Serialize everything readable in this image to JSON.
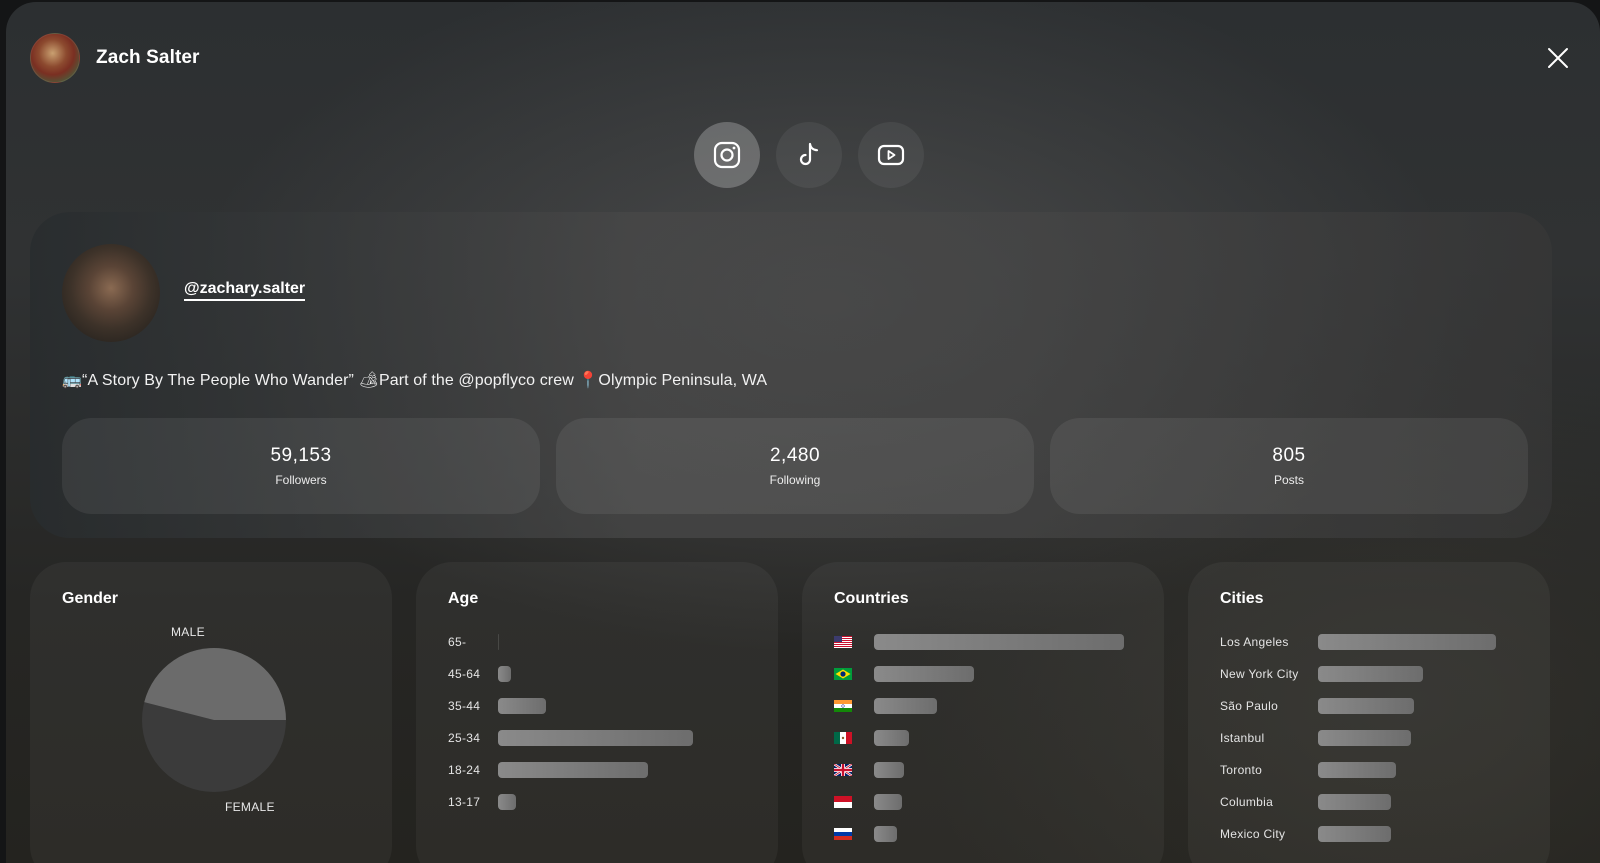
{
  "header": {
    "name": "Zach Salter"
  },
  "platforms": [
    {
      "name": "instagram",
      "active": true
    },
    {
      "name": "tiktok",
      "active": false
    },
    {
      "name": "youtube",
      "active": false
    }
  ],
  "profile": {
    "handle": "@zachary.salter",
    "bio": "🚌“A Story By The People Who Wander” 🏕Part of the @popflyco crew 📍Olympic Peninsula, WA"
  },
  "stats": [
    {
      "value": "59,153",
      "label": "Followers"
    },
    {
      "value": "2,480",
      "label": "Following"
    },
    {
      "value": "805",
      "label": "Posts"
    }
  ],
  "gender": {
    "title": "Gender",
    "male_label": "MALE",
    "female_label": "FEMALE",
    "male_share": 0.46,
    "female_share": 0.54
  },
  "age": {
    "title": "Age",
    "groups": [
      {
        "label": "65-",
        "value": 0
      },
      {
        "label": "45-64",
        "value": 0.05
      },
      {
        "label": "35-44",
        "value": 0.19
      },
      {
        "label": "25-34",
        "value": 0.78
      },
      {
        "label": "18-24",
        "value": 0.6
      },
      {
        "label": "13-17",
        "value": 0.07
      }
    ]
  },
  "countries": {
    "title": "Countries",
    "items": [
      {
        "flag": "us-flag-icon",
        "value": 1.0
      },
      {
        "flag": "br-flag-icon",
        "value": 0.4
      },
      {
        "flag": "in-flag-icon",
        "value": 0.25
      },
      {
        "flag": "mx-flag-icon",
        "value": 0.14
      },
      {
        "flag": "gb-flag-icon",
        "value": 0.12
      },
      {
        "flag": "id-flag-icon",
        "value": 0.11
      },
      {
        "flag": "ru-flag-icon",
        "value": 0.09
      }
    ]
  },
  "cities": {
    "title": "Cities",
    "items": [
      {
        "label": "Los Angeles",
        "value": 1.0
      },
      {
        "label": "New York City",
        "value": 0.59
      },
      {
        "label": "São Paulo",
        "value": 0.54
      },
      {
        "label": "Istanbul",
        "value": 0.52
      },
      {
        "label": "Toronto",
        "value": 0.44
      },
      {
        "label": "Columbia",
        "value": 0.41
      },
      {
        "label": "Mexico City",
        "value": 0.41
      }
    ]
  }
}
